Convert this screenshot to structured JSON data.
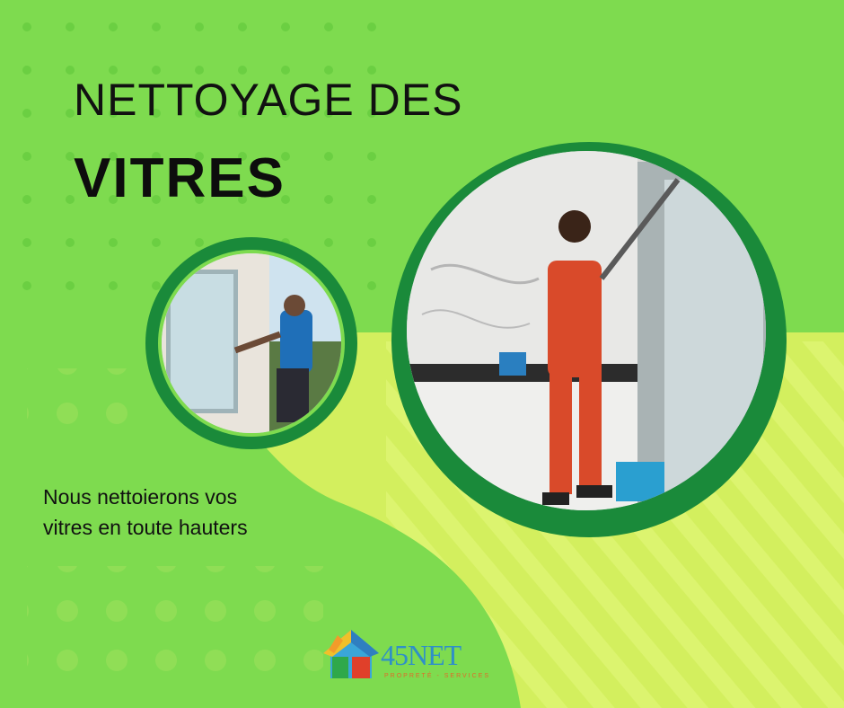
{
  "headline": {
    "line1": "NETTOYAGE DES",
    "line2": "VITRES"
  },
  "subtitle": {
    "line1": "Nous nettoierons vos",
    "line2": "vitres en toute hauters"
  },
  "logo": {
    "name": "45NET",
    "tagline": "PROPRETÉ - SERVICES"
  },
  "photos": {
    "small": "window-cleaner-outdoor-photo",
    "large": "window-cleaner-indoor-photo"
  },
  "colors": {
    "top_green": "#7edb4f",
    "lime": "#d3ef5e",
    "ring_green": "#1a8a3a",
    "dot": "#6bcf42"
  }
}
